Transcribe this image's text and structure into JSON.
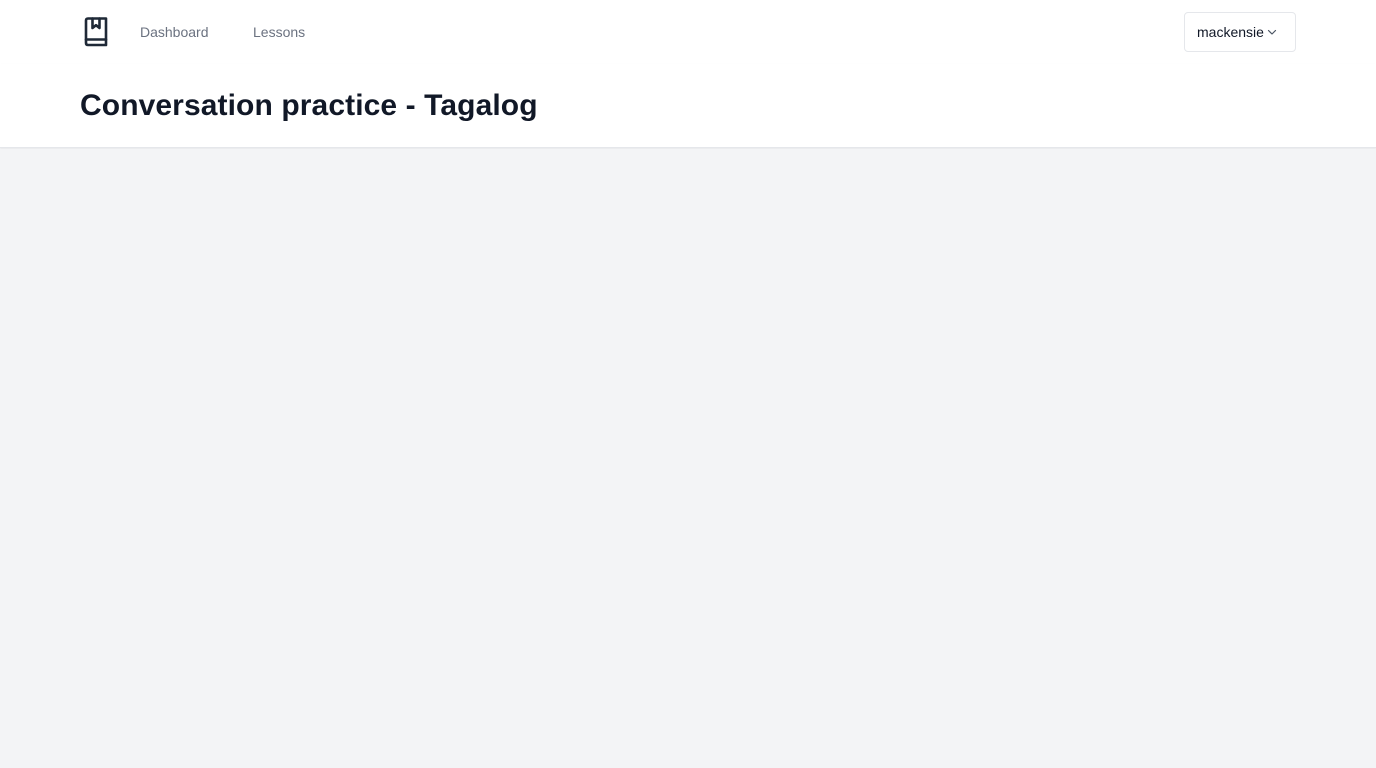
{
  "nav": {
    "logo_icon": "book-bookmark-icon",
    "links": [
      {
        "label": "Dashboard"
      },
      {
        "label": "Lessons"
      }
    ],
    "user": {
      "name": "mackensie",
      "chevron_icon": "chevron-down-icon"
    }
  },
  "header": {
    "title": "Conversation practice - Tagalog"
  },
  "colors": {
    "background": "#f3f4f6",
    "surface": "#ffffff",
    "text_primary": "#111827",
    "text_muted": "#6b7280",
    "border": "#e5e7eb"
  }
}
